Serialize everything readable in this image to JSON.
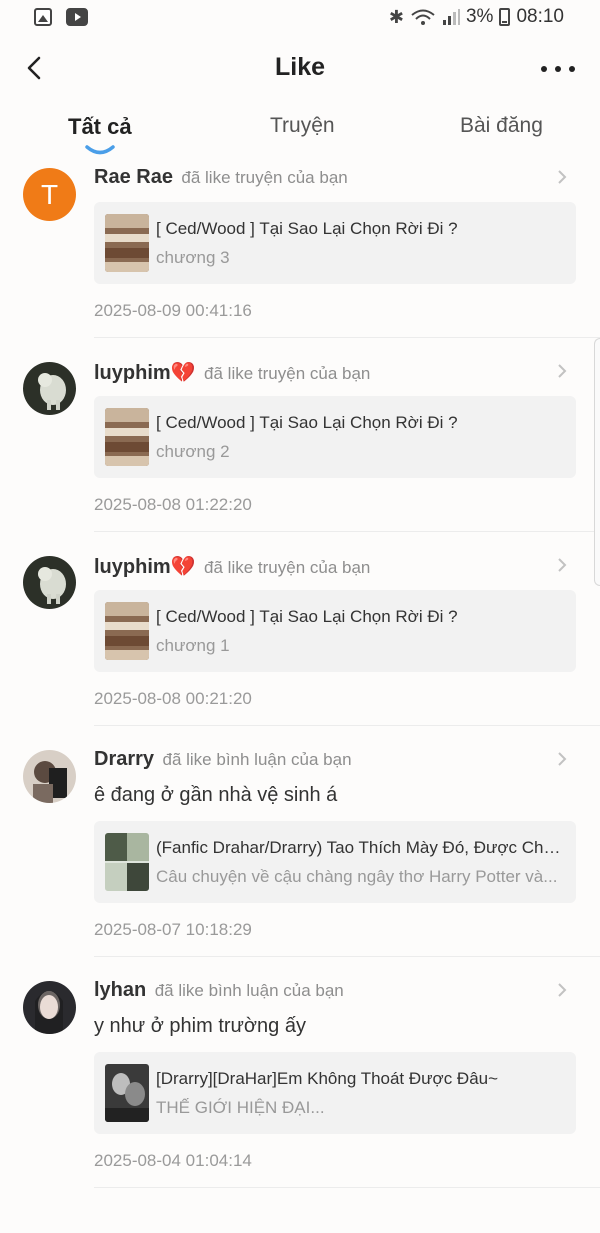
{
  "status_bar": {
    "battery": "3%",
    "time": "08:10",
    "icons": [
      "gallery-icon",
      "media-app-icon",
      "bluetooth-icon",
      "wifi-icon",
      "signal-icon",
      "battery-icon"
    ]
  },
  "header": {
    "title": "Like",
    "back_icon": "back-chevron-icon",
    "more_icon": "more-dots-icon"
  },
  "tabs": [
    {
      "label": "Tất cả",
      "active": true
    },
    {
      "label": "Truyện",
      "active": false
    },
    {
      "label": "Bài đăng",
      "active": false
    }
  ],
  "colors": {
    "accent": "#4a9ee8",
    "avatar_letter_bg": "#f07b17",
    "card_bg": "#f2f2f2"
  },
  "feed": [
    {
      "avatar_letter": "T",
      "username": "Rae Rae",
      "action": "đã like truyện của bạn",
      "comment": "",
      "card_title": "[ Ced/Wood ] Tại Sao Lại Chọn Rời Đi ?",
      "card_subtitle": "chương 3",
      "time": "2025-08-09 00:41:16"
    },
    {
      "username": "luyphim💔",
      "action": "đã like truyện của bạn",
      "comment": "",
      "card_title": "[ Ced/Wood ] Tại Sao Lại Chọn Rời Đi ?",
      "card_subtitle": "chương 2",
      "time": "2025-08-08 01:22:20"
    },
    {
      "username": "luyphim💔",
      "action": "đã like truyện của bạn",
      "comment": "",
      "card_title": "[ Ced/Wood ] Tại Sao Lại Chọn Rời Đi ?",
      "card_subtitle": "chương 1",
      "time": "2025-08-08 00:21:20"
    },
    {
      "username": "Drarry",
      "action": "đã like bình luận của bạn",
      "comment": "ê đang ở gần nhà vệ sinh á",
      "card_title": "(Fanfic Drahar/Drarry) Tao Thích Mày Đó, Được Chưa",
      "card_subtitle": "Câu chuyện về cậu chàng ngây thơ Harry Potter và...",
      "time": "2025-08-07 10:18:29"
    },
    {
      "username": "lyhan",
      "action": "đã like bình luận của bạn",
      "comment": "y như ở phim trường ấy",
      "card_title": "[Drarry][DraHar]Em Không Thoát Được Đâu~",
      "card_subtitle": "THẾ GIỚI HIỆN ĐẠI...",
      "time": "2025-08-04 01:04:14"
    }
  ]
}
